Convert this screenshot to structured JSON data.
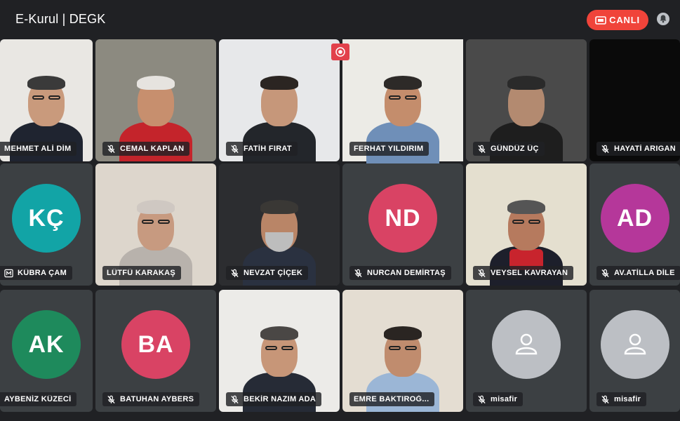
{
  "header": {
    "title": "E-Kurul | DEGK",
    "live_label": "CANLI"
  },
  "colors": {
    "background": "#202124",
    "tile": "#3c4043",
    "live": "#f0443a",
    "active_border": "#4a8df8"
  },
  "participants": [
    {
      "name": "MEHMET ALİ DİM",
      "muted": false,
      "avatar": null
    },
    {
      "name": "CEMAL KAPLAN",
      "muted": true,
      "avatar": null
    },
    {
      "name": "FATİH FIRAT",
      "muted": true,
      "avatar": null
    },
    {
      "name": "FERHAT YILDIRIM",
      "muted": false,
      "avatar": null,
      "speaking": true
    },
    {
      "name": "GÜNDÜZ ÜÇ",
      "muted": true,
      "avatar": null
    },
    {
      "name": "HAYATİ ARIGAN",
      "muted": true,
      "avatar": null
    },
    {
      "name": "KÜBRA ÇAM",
      "muted": false,
      "avatar": "KÇ",
      "avatar_color": "#12a4a6"
    },
    {
      "name": "LÜTFÜ KARAKAŞ",
      "muted": false,
      "avatar": null
    },
    {
      "name": "NEVZAT ÇİÇEK",
      "muted": true,
      "avatar": null
    },
    {
      "name": "NURCAN DEMİRTAŞ",
      "muted": true,
      "avatar": "ND",
      "avatar_color": "#d94364"
    },
    {
      "name": "VEYSEL KAVRAYAN",
      "muted": true,
      "avatar": null
    },
    {
      "name": "AV.ATİLLA DİLE",
      "muted": true,
      "avatar": "AD",
      "avatar_color": "#b5379a"
    },
    {
      "name": "AYBENİZ KÜZECİ",
      "muted": false,
      "avatar": "AK",
      "avatar_color": "#1e8a5c"
    },
    {
      "name": "BATUHAN AYBERS",
      "muted": true,
      "avatar": "BA",
      "avatar_color": "#d94364"
    },
    {
      "name": "BEKİR NAZIM ADA",
      "muted": true,
      "avatar": null
    },
    {
      "name": "EMRE BAKTIROĞ...",
      "muted": false,
      "avatar": null
    },
    {
      "name": "misafir",
      "muted": true,
      "avatar": "guest"
    },
    {
      "name": "misafir",
      "muted": true,
      "avatar": "guest"
    }
  ]
}
